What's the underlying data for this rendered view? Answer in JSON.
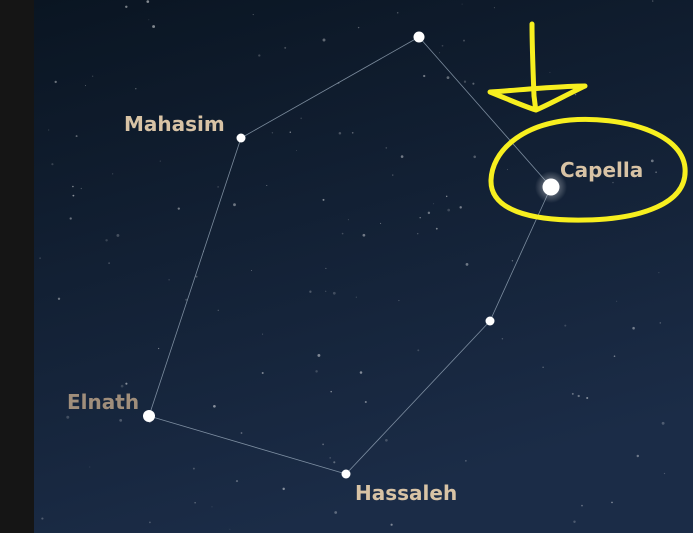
{
  "colors": {
    "sky_top": "#0a1522",
    "sky_bottom": "#1b2c47",
    "side_panel": "#151515",
    "label": "#d8c3a5",
    "label_dim": "#a08e7b",
    "constellation_line": "#9fb0c2",
    "star": "#ffffff",
    "annotation": "#f7ef1f"
  },
  "stars": [
    {
      "id": "top",
      "name": ""
    },
    {
      "id": "mahasim",
      "name": "Mahasim"
    },
    {
      "id": "capella",
      "name": "Capella"
    },
    {
      "id": "mid",
      "name": ""
    },
    {
      "id": "hassaleh",
      "name": "Hassaleh"
    },
    {
      "id": "elnath",
      "name": "Elnath"
    }
  ],
  "annotation": {
    "arrow_icon": "down-arrow-icon",
    "highlight": "circle-highlight",
    "target": "Capella"
  }
}
